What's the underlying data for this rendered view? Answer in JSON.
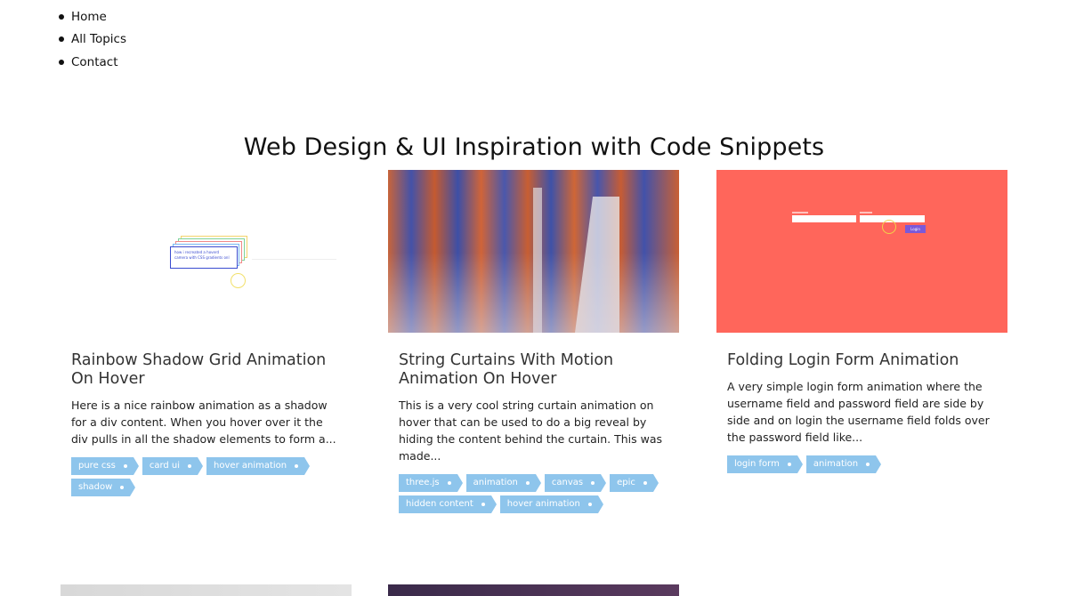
{
  "nav": {
    "items": [
      {
        "label": "Home"
      },
      {
        "label": "All Topics"
      },
      {
        "label": "Contact"
      }
    ]
  },
  "page": {
    "title": "Web Design & UI Inspiration with Code Snippets"
  },
  "cards": [
    {
      "title": "Rainbow Shadow Grid Animation On Hover",
      "description": "Here is a nice rainbow animation as a shadow for a div content. When you hover over it the div pulls in all the shadow elements to form a...",
      "tags": [
        "pure css",
        "card ui",
        "hover animation",
        "shadow"
      ],
      "thumb_text": "how i recreated a hoverd camera with CSS gradients onl"
    },
    {
      "title": "String Curtains With Motion Animation On Hover",
      "description": "This is a very cool string curtain animation on hover that can be used to do a big reveal by hiding the content behind the curtain. This was made...",
      "tags": [
        "three.js",
        "animation",
        "canvas",
        "epic",
        "hidden content",
        "hover animation"
      ]
    },
    {
      "title": "Folding Login Form Animation",
      "description": "A very simple login form animation where the username field and password field are side by side and on login the username field folds over the password field like...",
      "tags": [
        "login form",
        "animation"
      ],
      "thumb_button": "Login"
    }
  ],
  "colors": {
    "tag_bg": "#8ec5ec",
    "card3_bg": "#ff665b",
    "login_btn": "#7b59d9"
  }
}
